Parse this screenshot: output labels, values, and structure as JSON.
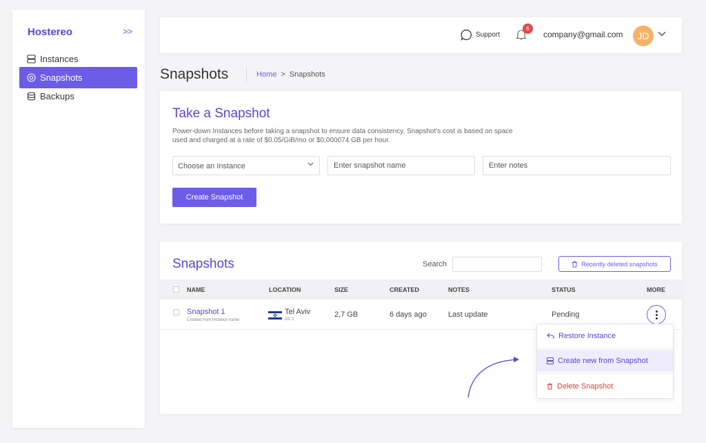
{
  "sidebar": {
    "brand": "Hostereo",
    "collapse_icon": "double-chevron-right-icon",
    "items": [
      {
        "label": "Instances",
        "icon": "server-icon",
        "active": false
      },
      {
        "label": "Snapshots",
        "icon": "snapshot-icon",
        "active": true
      },
      {
        "label": "Backups",
        "icon": "database-icon",
        "active": false
      }
    ]
  },
  "topbar": {
    "support_label": "Support",
    "notifications_count": "6",
    "email": "company@gmail.com",
    "avatar_initials": "JD"
  },
  "page": {
    "title": "Snapshots",
    "breadcrumb": {
      "home": "Home",
      "separator": ">",
      "current": "Snapshots"
    }
  },
  "take_snapshot": {
    "title": "Take a Snapshot",
    "description": "Power-down Instances before taking a snapshot to ensure data consistency. Snapshot's cost is based on space used and charged at a rate of $0.05/GiB/mo or $0,000074 GB per hour.",
    "instance_select_placeholder": "Choose an Instance",
    "name_placeholder": "Enter snapshot name",
    "notes_placeholder": "Enter notes",
    "create_button": "Create Snapshot"
  },
  "snapshots_table": {
    "title": "Snapshots",
    "search_label": "Search",
    "recently_deleted_button": "Recently deleted snapshots",
    "columns": {
      "name": "NAME",
      "location": "LOCATION",
      "size": "SIZE",
      "created": "CREATED",
      "notes": "NOTES",
      "status": "STATUS",
      "more": "MORE"
    },
    "rows": [
      {
        "name": "Snapshot 1",
        "subtitle": "Created from Instance name",
        "city": "Tel Aviv",
        "dc": "DC 1",
        "size": "2,7 GB",
        "created": "6 days ago",
        "notes": "Last update",
        "status": "Pending"
      }
    ]
  },
  "more_menu": {
    "items": [
      {
        "label": "Restore Instance",
        "icon": "undo-arrow-icon"
      },
      {
        "label": "Create new from Snapshot",
        "icon": "server-icon"
      },
      {
        "label": "Delete Snapshot",
        "icon": "trash-icon"
      }
    ]
  },
  "colors": {
    "accent": "#6c5ce7",
    "brand": "#5b43d6",
    "danger": "#d9413b",
    "badge": "#e24a4a",
    "avatar": "#f7b267"
  }
}
